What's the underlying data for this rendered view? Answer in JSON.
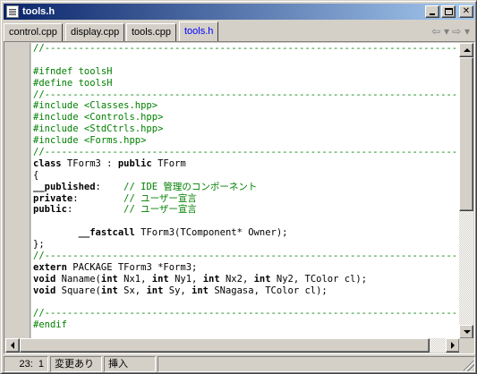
{
  "window": {
    "title": "tools.h",
    "buttons": {
      "minimize": "minimize",
      "maximize": "maximize",
      "close": "✕"
    }
  },
  "tabs": [
    {
      "label": "control.cpp",
      "active": false
    },
    {
      "label": "display.cpp",
      "active": false
    },
    {
      "label": "tools.cpp",
      "active": false
    },
    {
      "label": "tools.h",
      "active": true
    }
  ],
  "nav": {
    "back": "⇦ ▾",
    "forward": "⇨ ▾"
  },
  "code_lines": [
    {
      "text": "//---------------------------------------------------------------------------",
      "kind": "cmt"
    },
    {
      "text": "",
      "kind": "plain"
    },
    {
      "text": "#ifndef toolsH",
      "kind": "dir"
    },
    {
      "text": "#define toolsH",
      "kind": "dir"
    },
    {
      "text": "//---------------------------------------------------------------------------",
      "kind": "cmt"
    },
    {
      "text": "#include <Classes.hpp>",
      "kind": "dir"
    },
    {
      "text": "#include <Controls.hpp>",
      "kind": "dir"
    },
    {
      "text": "#include <StdCtrls.hpp>",
      "kind": "dir"
    },
    {
      "text": "#include <Forms.hpp>",
      "kind": "dir"
    },
    {
      "text": "//---------------------------------------------------------------------------",
      "kind": "cmt"
    },
    {
      "parts": [
        [
          "kw",
          "class"
        ],
        [
          "p",
          " TForm3 : "
        ],
        [
          "kw",
          "public"
        ],
        [
          "p",
          " TForm"
        ]
      ]
    },
    {
      "text": "{",
      "kind": "plain"
    },
    {
      "parts": [
        [
          "kw",
          "__published"
        ],
        [
          "p",
          ":    "
        ],
        [
          "cmt",
          "// IDE 管理のコンポーネント"
        ]
      ]
    },
    {
      "parts": [
        [
          "kw",
          "private"
        ],
        [
          "p",
          ":        "
        ],
        [
          "cmt",
          "// ユーザー宣言"
        ]
      ]
    },
    {
      "parts": [
        [
          "kw",
          "public"
        ],
        [
          "p",
          ":         "
        ],
        [
          "cmt",
          "// ユーザー宣言"
        ]
      ]
    },
    {
      "text": "",
      "kind": "plain"
    },
    {
      "parts": [
        [
          "p",
          "        "
        ],
        [
          "kw",
          "__fastcall"
        ],
        [
          "p",
          " TForm3(TComponent* Owner);"
        ]
      ]
    },
    {
      "text": "};",
      "kind": "plain"
    },
    {
      "text": "//---------------------------------------------------------------------------",
      "kind": "cmt"
    },
    {
      "parts": [
        [
          "kw",
          "extern"
        ],
        [
          "p",
          " PACKAGE TForm3 *Form3;"
        ]
      ]
    },
    {
      "parts": [
        [
          "kw",
          "void"
        ],
        [
          "p",
          " Naname("
        ],
        [
          "kw",
          "int"
        ],
        [
          "p",
          " Nx1, "
        ],
        [
          "kw",
          "int"
        ],
        [
          "p",
          " Ny1, "
        ],
        [
          "kw",
          "int"
        ],
        [
          "p",
          " Nx2, "
        ],
        [
          "kw",
          "int"
        ],
        [
          "p",
          " Ny2, TColor cl);"
        ]
      ]
    },
    {
      "parts": [
        [
          "kw",
          "void"
        ],
        [
          "p",
          " Square("
        ],
        [
          "kw",
          "int"
        ],
        [
          "p",
          " Sx, "
        ],
        [
          "kw",
          "int"
        ],
        [
          "p",
          " Sy, "
        ],
        [
          "kw",
          "int"
        ],
        [
          "p",
          " SNagasa, TColor cl);"
        ]
      ]
    },
    {
      "text": "",
      "kind": "plain"
    },
    {
      "text": "//---------------------------------------------------------------------------",
      "kind": "cmt"
    },
    {
      "text": "#endif",
      "kind": "dir"
    }
  ],
  "status": {
    "line": "23",
    "col": "1",
    "modified": "変更あり",
    "insert_mode": "挿入"
  }
}
